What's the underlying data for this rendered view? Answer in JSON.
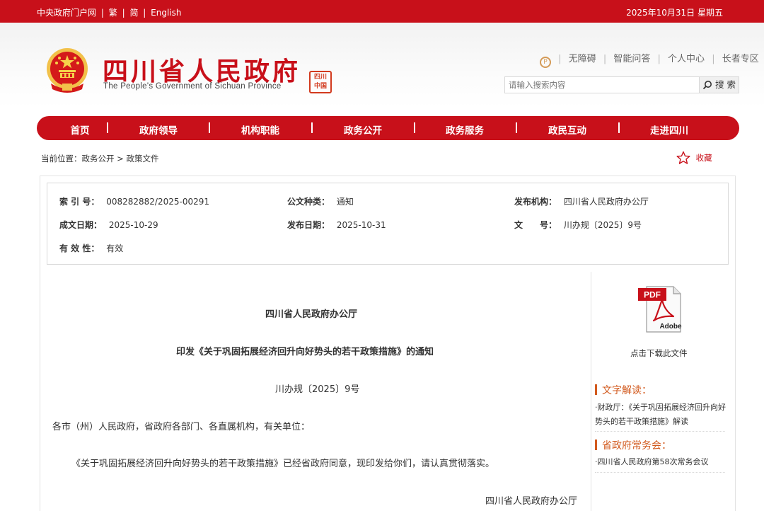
{
  "topbar": {
    "portal": "中央政府门户网",
    "traditional": "繁",
    "simplified": "简",
    "english": "English",
    "sep": "|",
    "date": "2025年10月31日 星期五"
  },
  "header": {
    "title_cn": "四川省人民政府",
    "title_en": "The People's Government of Sichuan Province",
    "seal_text": "四川中国",
    "tools": [
      "无障碍",
      "智能问答",
      "个人中心",
      "长者专区"
    ],
    "tools_sep": "|",
    "search_placeholder": "请输入搜索内容",
    "search_button": "搜 索"
  },
  "nav": {
    "items": [
      "首页",
      "政府领导",
      "机构职能",
      "政务公开",
      "政务服务",
      "政民互动",
      "走进四川"
    ]
  },
  "breadcrumb": {
    "text": "当前位置：政务公开 > 政策文件"
  },
  "favorite": {
    "label": "收藏"
  },
  "meta": {
    "index_label": "索 引 号：",
    "index_value": "008282882/2025-00291",
    "type_label": "公文种类：",
    "type_value": "通知",
    "issuer_label": "发布机构：",
    "issuer_value": "四川省人民政府办公厅",
    "created_label": "成文日期：",
    "created_value": "2025-10-29",
    "published_label": "发布日期：",
    "published_value": "2025-10-31",
    "docno_label": "文　　号：",
    "docno_value": "川办规〔2025〕9号",
    "validity_label": "有 效 性：",
    "validity_value": "有效"
  },
  "document": {
    "org": "四川省人民政府办公厅",
    "title": "印发《关于巩固拓展经济回升向好势头的若干政策措施》的通知",
    "number": "川办规〔2025〕9号",
    "salutation": "各市（州）人民政府，省政府各部门、各直属机构，有关单位：",
    "body": "《关于巩固拓展经济回升向好势头的若干政策措施》已经省政府同意，现印发给你们，请认真贯彻落实。",
    "signature": "四川省人民政府办公厅"
  },
  "sidebar": {
    "pdf_badge": "PDF",
    "pdf_brand": "Adobe",
    "download_label": "点击下载此文件",
    "interpretation_heading": "文字解读：",
    "interpretation_text": "·财政厅：《关于巩固拓展经济回升向好势头的若干政策措施》解读",
    "meeting_heading": "省政府常务会：",
    "meeting_text": "·四川省人民政府第58次常务会议"
  },
  "colors": {
    "brand_red": "#c8101a",
    "sidebar_orange": "#d25a1e"
  }
}
